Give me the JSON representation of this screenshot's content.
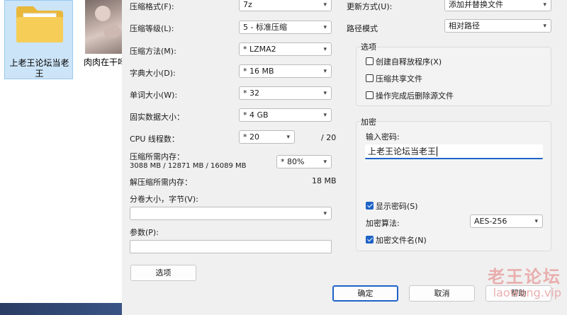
{
  "explorer": {
    "folder_label": "上老王论坛当老王",
    "video_label": "肉肉在干吗玩具.m"
  },
  "left": {
    "format_label": "压缩格式(F):",
    "format_value": "7z",
    "level_label": "压缩等级(L):",
    "level_value": "5 - 标准压缩",
    "method_label": "压缩方法(M):",
    "method_value": "* LZMA2",
    "dict_label": "字典大小(D):",
    "dict_value": "* 16 MB",
    "word_label": "单词大小(W):",
    "word_value": "* 32",
    "solid_label": "固实数据大小：",
    "solid_value": "* 4 GB",
    "cpu_label": "CPU 线程数：",
    "cpu_value": "* 20",
    "cpu_total": "/ 20",
    "mem_label": "压缩所需内存：",
    "mem_detail": "3088 MB / 12871 MB / 16089 MB",
    "mem_percent": "* 80%",
    "decomp_label": "解压缩所需内存：",
    "decomp_value": "18 MB",
    "split_label": "分卷大小，字节(V):",
    "split_value": "",
    "params_label": "参数(P):",
    "params_value": "",
    "options_button": "选项"
  },
  "right": {
    "update_label": "更新方式(U):",
    "update_value": "添加并替换文件",
    "path_label": "路径模式",
    "path_value": "相对路径",
    "options_group": "选项",
    "opt_sfx": "创建自释放程序(X)",
    "opt_shared": "压缩共享文件",
    "opt_delete": "操作完成后删除源文件",
    "encrypt_group": "加密",
    "password_label": "输入密码:",
    "password_value": "上老王论坛当老王",
    "show_password": "显示密码(S)",
    "method_label": "加密算法:",
    "method_value": "AES-256",
    "encrypt_names": "加密文件名(N)"
  },
  "buttons": {
    "ok": "确定",
    "cancel": "取消",
    "help": "帮助"
  },
  "watermark": {
    "title": "老王论坛",
    "url": "laowang.vip"
  },
  "icons": {
    "dropdown": "▾"
  }
}
